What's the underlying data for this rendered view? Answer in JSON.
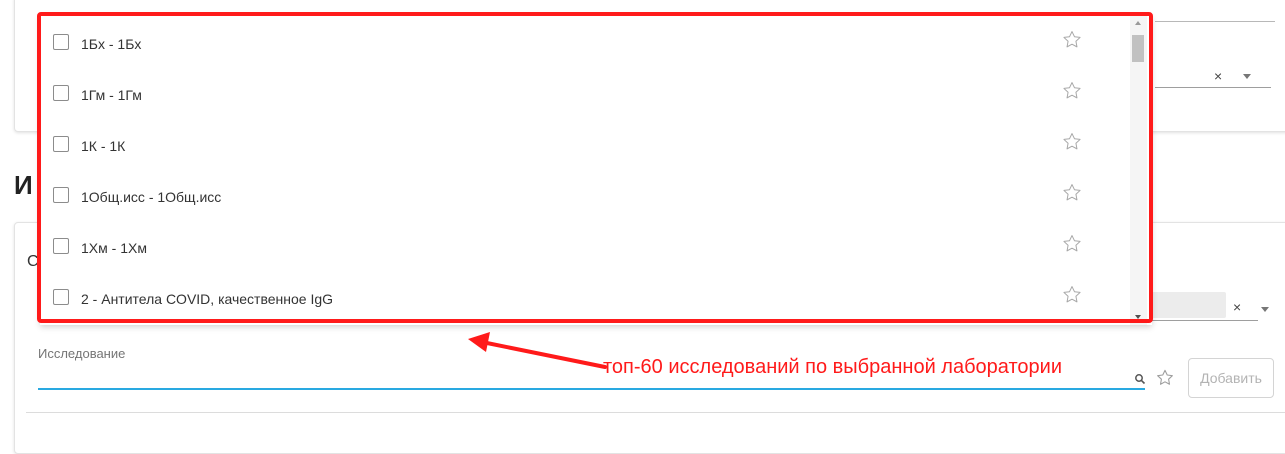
{
  "section": {
    "heading_partial": "И",
    "left_letter": "С"
  },
  "dropdown": {
    "options": [
      {
        "label": "1Бх - 1Бх",
        "checked": false,
        "favorite": false
      },
      {
        "label": "1Гм - 1Гм",
        "checked": false,
        "favorite": false
      },
      {
        "label": "1К - 1К",
        "checked": false,
        "favorite": false
      },
      {
        "label": "1Общ.исс - 1Общ.исс",
        "checked": false,
        "favorite": false
      },
      {
        "label": "1Хм - 1Хм",
        "checked": false,
        "favorite": false
      },
      {
        "label": "2 - Антитела COVID, качественное IgG",
        "checked": false,
        "favorite": false
      }
    ]
  },
  "clear_symbol": "×",
  "study_field": {
    "label": "Исследование",
    "value": ""
  },
  "add_button_label": "Добавить",
  "annotation": {
    "text": "топ-60 исследований по выбранной лаборатории",
    "color": "#ff1a1a"
  },
  "colors": {
    "input_underline": "#29a9e1",
    "highlight": "#ff1a1a"
  },
  "icons": [
    "checkbox-icon",
    "star-icon",
    "search-icon",
    "clear-icon",
    "chevron-down-icon",
    "arrow-icon"
  ]
}
